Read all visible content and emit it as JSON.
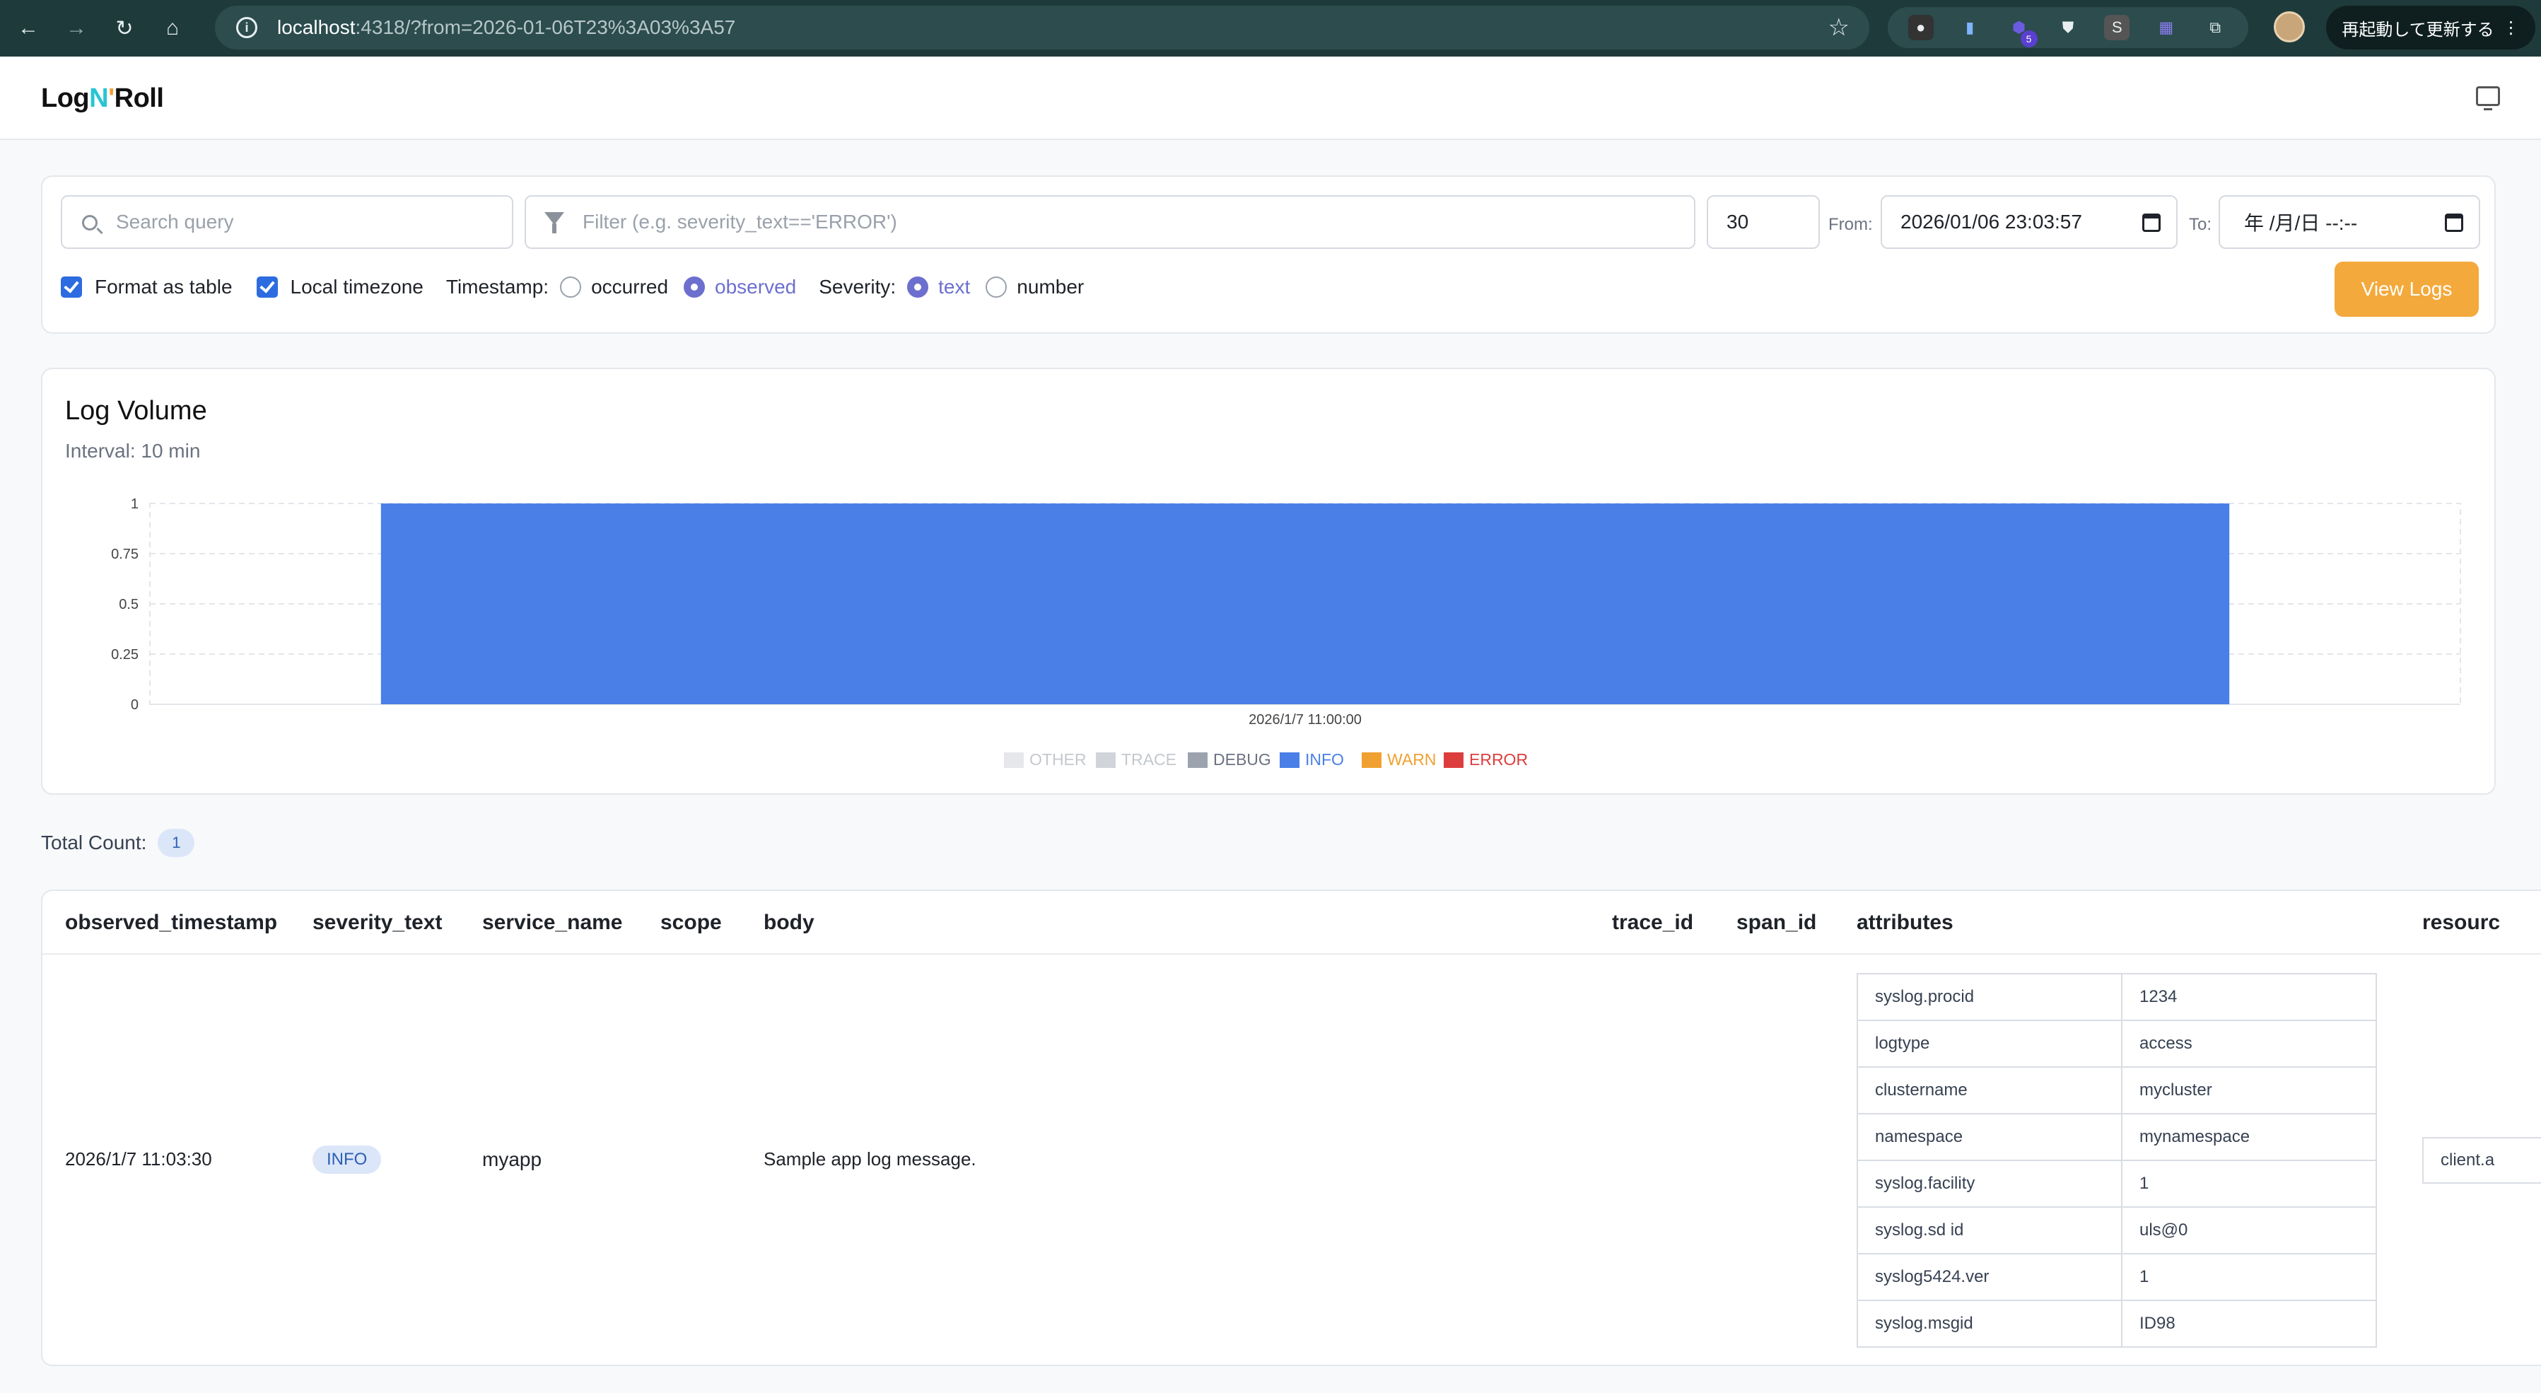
{
  "browser": {
    "url_host": "localhost",
    "url_path": ":4318/?from=2026-01-06T23%3A03%3A57",
    "relaunch_label": "再起動して更新する",
    "ext_badge": "5"
  },
  "app": {
    "logo_a": "Log",
    "logo_n": "N",
    "logo_ap": "'",
    "logo_b": "Roll"
  },
  "filters": {
    "search_placeholder": "Search query",
    "filter_placeholder": "Filter (e.g. severity_text=='ERROR')",
    "limit": "30",
    "from_label": "From:",
    "from_value": "2026/01/06 23:03:57",
    "to_label": "To:",
    "to_value": "年 /月/日 --:--",
    "format_table_label": "Format as table",
    "local_tz_label": "Local timezone",
    "timestamp_label": "Timestamp:",
    "ts_occurred": "occurred",
    "ts_observed": "observed",
    "severity_label": "Severity:",
    "sev_text": "text",
    "sev_number": "number",
    "view_logs": "View Logs"
  },
  "chart_data": {
    "type": "bar",
    "title": "Log Volume",
    "subtitle": "Interval: 10 min",
    "categories": [
      "2026/1/7 11:00:00"
    ],
    "series": [
      {
        "name": "OTHER",
        "color": "#e5e7eb",
        "values": [
          0
        ]
      },
      {
        "name": "TRACE",
        "color": "#d1d5db",
        "values": [
          0
        ]
      },
      {
        "name": "DEBUG",
        "color": "#9ca3af",
        "values": [
          0
        ]
      },
      {
        "name": "INFO",
        "color": "#4a7fe8",
        "values": [
          1
        ]
      },
      {
        "name": "WARN",
        "color": "#f0a030",
        "values": [
          0
        ]
      },
      {
        "name": "ERROR",
        "color": "#dc3e3e",
        "values": [
          0
        ]
      }
    ],
    "yticks": [
      "1",
      "0.75",
      "0.5",
      "0.25",
      "0"
    ],
    "ylim": [
      0,
      1
    ],
    "grid": true,
    "legend_position": "bottom"
  },
  "summary": {
    "total_label": "Total Count:",
    "total_value": "1"
  },
  "table": {
    "columns": [
      "observed_timestamp",
      "severity_text",
      "service_name",
      "scope",
      "body",
      "trace_id",
      "span_id",
      "attributes",
      "resourc"
    ],
    "row": {
      "observed_timestamp": "2026/1/7 11:03:30",
      "severity_text": "INFO",
      "service_name": "myapp",
      "scope": "",
      "body": "Sample app log message.",
      "resource_preview": "client.a"
    },
    "attributes": [
      {
        "k": "syslog.procid",
        "v": "1234"
      },
      {
        "k": "logtype",
        "v": "access"
      },
      {
        "k": "clustername",
        "v": "mycluster"
      },
      {
        "k": "namespace",
        "v": "mynamespace"
      },
      {
        "k": "syslog.facility",
        "v": "1"
      },
      {
        "k": "syslog.sd id",
        "v": "uls@0"
      },
      {
        "k": "syslog5424.ver",
        "v": "1"
      },
      {
        "k": "syslog.msgid",
        "v": "ID98"
      }
    ]
  }
}
